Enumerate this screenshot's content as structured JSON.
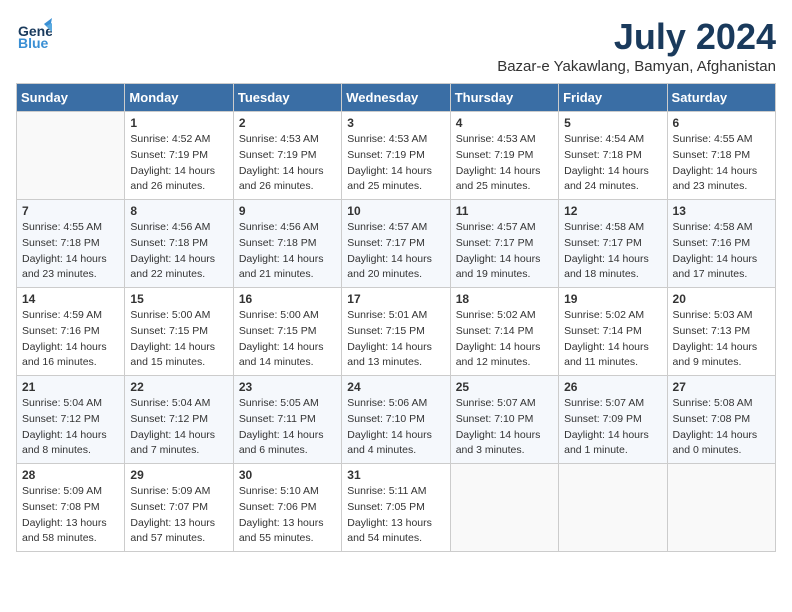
{
  "logo": {
    "text1": "General",
    "text2": "Blue"
  },
  "title": "July 2024",
  "location": "Bazar-e Yakawlang, Bamyan, Afghanistan",
  "days_of_week": [
    "Sunday",
    "Monday",
    "Tuesday",
    "Wednesday",
    "Thursday",
    "Friday",
    "Saturday"
  ],
  "weeks": [
    [
      {
        "day": "",
        "info": ""
      },
      {
        "day": "1",
        "info": "Sunrise: 4:52 AM\nSunset: 7:19 PM\nDaylight: 14 hours\nand 26 minutes."
      },
      {
        "day": "2",
        "info": "Sunrise: 4:53 AM\nSunset: 7:19 PM\nDaylight: 14 hours\nand 26 minutes."
      },
      {
        "day": "3",
        "info": "Sunrise: 4:53 AM\nSunset: 7:19 PM\nDaylight: 14 hours\nand 25 minutes."
      },
      {
        "day": "4",
        "info": "Sunrise: 4:53 AM\nSunset: 7:19 PM\nDaylight: 14 hours\nand 25 minutes."
      },
      {
        "day": "5",
        "info": "Sunrise: 4:54 AM\nSunset: 7:18 PM\nDaylight: 14 hours\nand 24 minutes."
      },
      {
        "day": "6",
        "info": "Sunrise: 4:55 AM\nSunset: 7:18 PM\nDaylight: 14 hours\nand 23 minutes."
      }
    ],
    [
      {
        "day": "7",
        "info": "Sunrise: 4:55 AM\nSunset: 7:18 PM\nDaylight: 14 hours\nand 23 minutes."
      },
      {
        "day": "8",
        "info": "Sunrise: 4:56 AM\nSunset: 7:18 PM\nDaylight: 14 hours\nand 22 minutes."
      },
      {
        "day": "9",
        "info": "Sunrise: 4:56 AM\nSunset: 7:18 PM\nDaylight: 14 hours\nand 21 minutes."
      },
      {
        "day": "10",
        "info": "Sunrise: 4:57 AM\nSunset: 7:17 PM\nDaylight: 14 hours\nand 20 minutes."
      },
      {
        "day": "11",
        "info": "Sunrise: 4:57 AM\nSunset: 7:17 PM\nDaylight: 14 hours\nand 19 minutes."
      },
      {
        "day": "12",
        "info": "Sunrise: 4:58 AM\nSunset: 7:17 PM\nDaylight: 14 hours\nand 18 minutes."
      },
      {
        "day": "13",
        "info": "Sunrise: 4:58 AM\nSunset: 7:16 PM\nDaylight: 14 hours\nand 17 minutes."
      }
    ],
    [
      {
        "day": "14",
        "info": "Sunrise: 4:59 AM\nSunset: 7:16 PM\nDaylight: 14 hours\nand 16 minutes."
      },
      {
        "day": "15",
        "info": "Sunrise: 5:00 AM\nSunset: 7:15 PM\nDaylight: 14 hours\nand 15 minutes."
      },
      {
        "day": "16",
        "info": "Sunrise: 5:00 AM\nSunset: 7:15 PM\nDaylight: 14 hours\nand 14 minutes."
      },
      {
        "day": "17",
        "info": "Sunrise: 5:01 AM\nSunset: 7:15 PM\nDaylight: 14 hours\nand 13 minutes."
      },
      {
        "day": "18",
        "info": "Sunrise: 5:02 AM\nSunset: 7:14 PM\nDaylight: 14 hours\nand 12 minutes."
      },
      {
        "day": "19",
        "info": "Sunrise: 5:02 AM\nSunset: 7:14 PM\nDaylight: 14 hours\nand 11 minutes."
      },
      {
        "day": "20",
        "info": "Sunrise: 5:03 AM\nSunset: 7:13 PM\nDaylight: 14 hours\nand 9 minutes."
      }
    ],
    [
      {
        "day": "21",
        "info": "Sunrise: 5:04 AM\nSunset: 7:12 PM\nDaylight: 14 hours\nand 8 minutes."
      },
      {
        "day": "22",
        "info": "Sunrise: 5:04 AM\nSunset: 7:12 PM\nDaylight: 14 hours\nand 7 minutes."
      },
      {
        "day": "23",
        "info": "Sunrise: 5:05 AM\nSunset: 7:11 PM\nDaylight: 14 hours\nand 6 minutes."
      },
      {
        "day": "24",
        "info": "Sunrise: 5:06 AM\nSunset: 7:10 PM\nDaylight: 14 hours\nand 4 minutes."
      },
      {
        "day": "25",
        "info": "Sunrise: 5:07 AM\nSunset: 7:10 PM\nDaylight: 14 hours\nand 3 minutes."
      },
      {
        "day": "26",
        "info": "Sunrise: 5:07 AM\nSunset: 7:09 PM\nDaylight: 14 hours\nand 1 minute."
      },
      {
        "day": "27",
        "info": "Sunrise: 5:08 AM\nSunset: 7:08 PM\nDaylight: 14 hours\nand 0 minutes."
      }
    ],
    [
      {
        "day": "28",
        "info": "Sunrise: 5:09 AM\nSunset: 7:08 PM\nDaylight: 13 hours\nand 58 minutes."
      },
      {
        "day": "29",
        "info": "Sunrise: 5:09 AM\nSunset: 7:07 PM\nDaylight: 13 hours\nand 57 minutes."
      },
      {
        "day": "30",
        "info": "Sunrise: 5:10 AM\nSunset: 7:06 PM\nDaylight: 13 hours\nand 55 minutes."
      },
      {
        "day": "31",
        "info": "Sunrise: 5:11 AM\nSunset: 7:05 PM\nDaylight: 13 hours\nand 54 minutes."
      },
      {
        "day": "",
        "info": ""
      },
      {
        "day": "",
        "info": ""
      },
      {
        "day": "",
        "info": ""
      }
    ]
  ]
}
